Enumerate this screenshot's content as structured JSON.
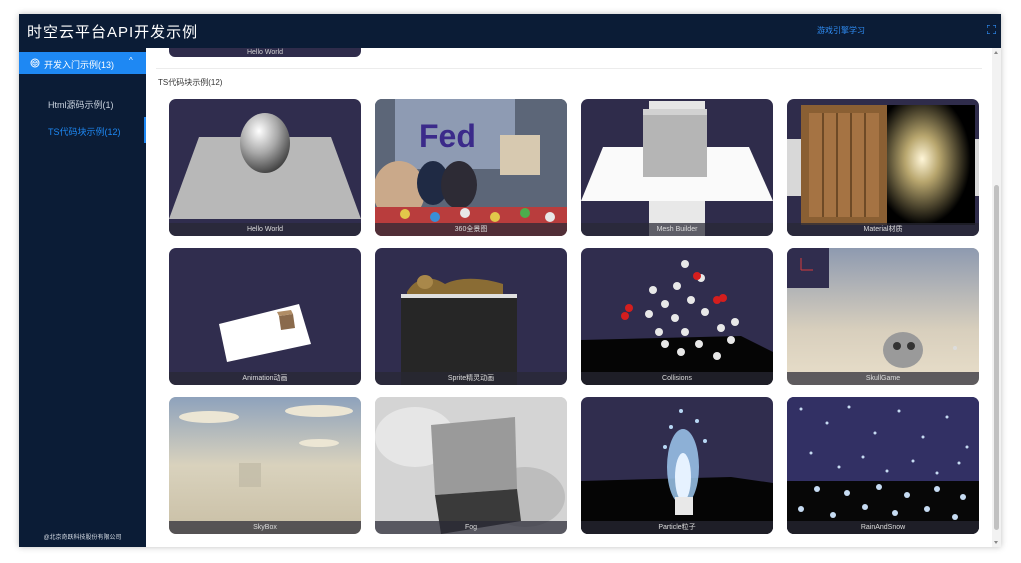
{
  "header": {
    "title": "时空云平台API开发示例",
    "link": "游戏引擎学习",
    "expand_icon": "expand-icon"
  },
  "sidebar": {
    "group": {
      "label": "开发入门示例(13)",
      "icon": "cube-icon",
      "chevron": "chevron-up-icon"
    },
    "items": [
      {
        "label": "Html源码示例(1)",
        "active": false
      },
      {
        "label": "TS代码块示例(12)",
        "active": true
      }
    ],
    "copyright": "@北京奇跃科技股份有限公司"
  },
  "content": {
    "previous_card_label": "Hello World",
    "section_title": "TS代码块示例(12)",
    "cards": [
      {
        "label": "Hello World"
      },
      {
        "label": "360全景图"
      },
      {
        "label": "Mesh Builder"
      },
      {
        "label": "Material材质"
      },
      {
        "label": "Animation动画"
      },
      {
        "label": "Sprite精灵动画"
      },
      {
        "label": "Collisions"
      },
      {
        "label": "SkullGame"
      },
      {
        "label": "SkyBox"
      },
      {
        "label": "Fog"
      },
      {
        "label": "Particle粒子"
      },
      {
        "label": "RainAndSnow"
      }
    ]
  },
  "colors": {
    "nav_bg": "#0b1c36",
    "accent": "#1e88f3",
    "card_bg": "#2f2c4b"
  }
}
